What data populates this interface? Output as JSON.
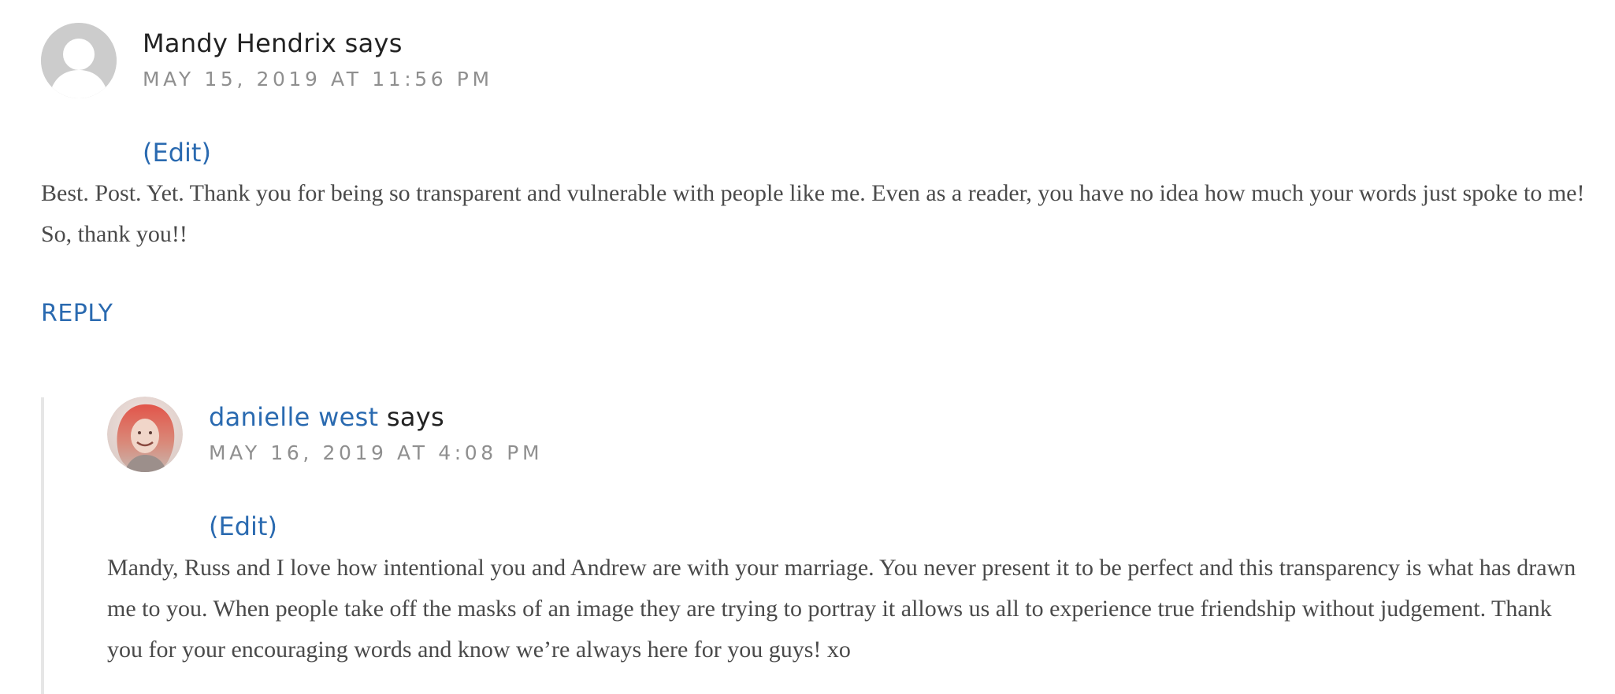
{
  "comments": [
    {
      "author": "Mandy Hendrix",
      "says": "says",
      "date": "MAY 15, 2019 AT 11:56 PM",
      "edit_label": "(Edit)",
      "text": "Best. Post. Yet. Thank you for being so transparent and vulnerable with people like me. Even as a reader, you have no idea how much your words just spoke to me! So, thank you!!",
      "reply_label": "REPLY",
      "avatar_icon": "default-person-icon"
    },
    {
      "author": "danielle west",
      "says": "says",
      "date": "MAY 16, 2019 AT 4:08 PM",
      "edit_label": "(Edit)",
      "text": "Mandy, Russ and I love how intentional you and Andrew are with your marriage. You never present it to be perfect and this transparency is what has drawn me to you. When people take off the masks of an image they are trying to portray it allows us all to experience true friendship without judgement. Thank you for your encouraging words and know we’re always here for you guys! xo",
      "avatar_icon": "user-photo-avatar"
    }
  ],
  "colors": {
    "link": "#2a6ab0",
    "meta": "#8f8f8f",
    "body": "#4a4a4a",
    "thread_line": "#e6e6e6"
  }
}
